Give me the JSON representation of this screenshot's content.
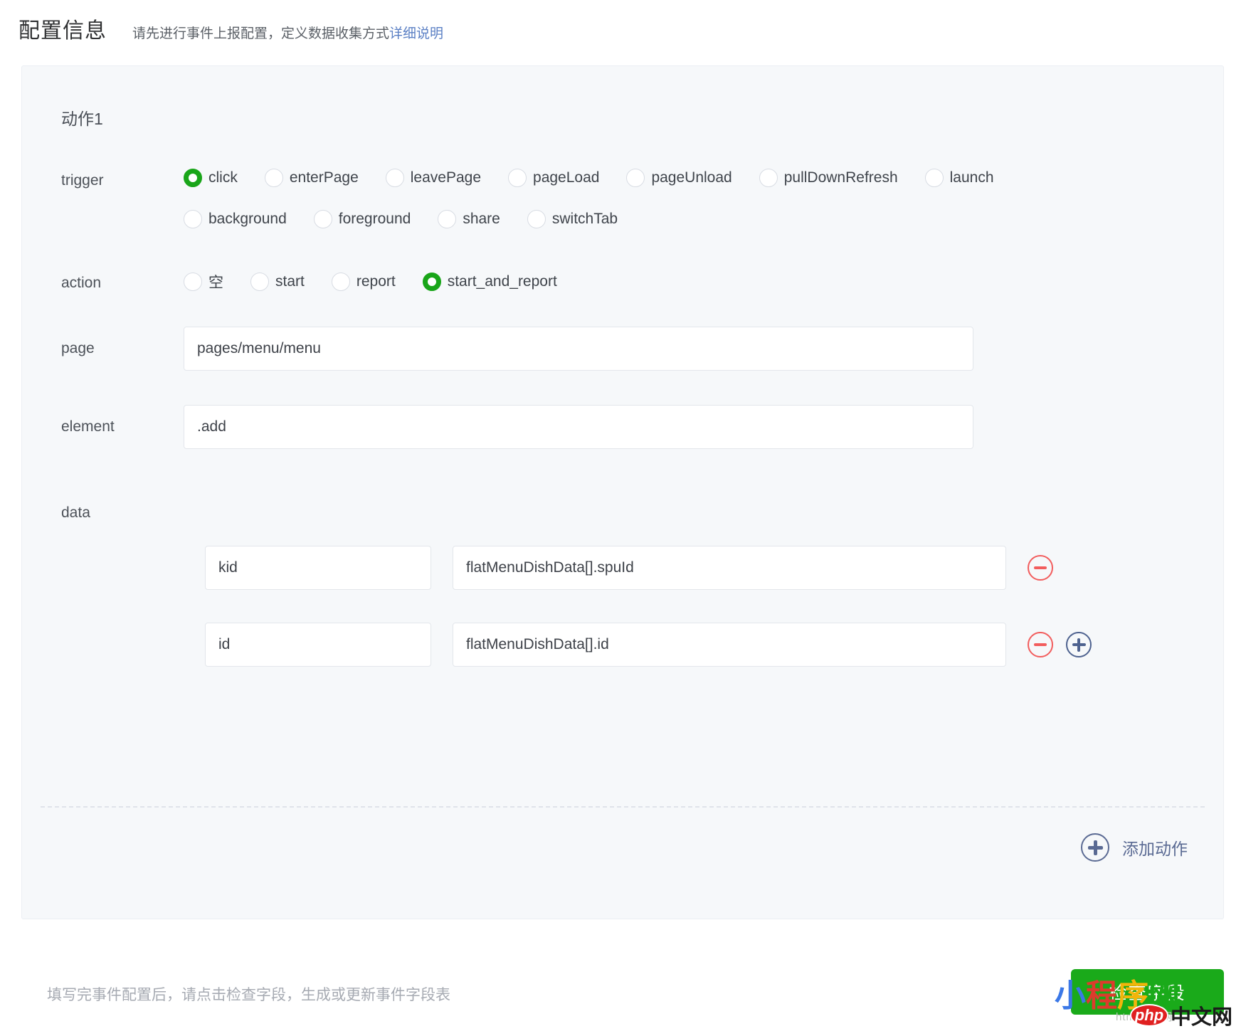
{
  "header": {
    "title": "配置信息",
    "subtitle": "请先进行事件上报配置，定义数据收集方式",
    "link": "详细说明"
  },
  "panel": {
    "action_title": "动作1"
  },
  "trigger": {
    "label": "trigger",
    "row1": [
      {
        "label": "click",
        "checked": true
      },
      {
        "label": "enterPage",
        "checked": false
      },
      {
        "label": "leavePage",
        "checked": false
      },
      {
        "label": "pageLoad",
        "checked": false
      },
      {
        "label": "pageUnload",
        "checked": false
      },
      {
        "label": "pullDownRefresh",
        "checked": false
      },
      {
        "label": "launch",
        "checked": false
      }
    ],
    "row2": [
      {
        "label": "background",
        "checked": false
      },
      {
        "label": "foreground",
        "checked": false
      },
      {
        "label": "share",
        "checked": false
      },
      {
        "label": "switchTab",
        "checked": false
      }
    ]
  },
  "action": {
    "label": "action",
    "options": [
      {
        "label": "空",
        "checked": false
      },
      {
        "label": "start",
        "checked": false
      },
      {
        "label": "report",
        "checked": false
      },
      {
        "label": "start_and_report",
        "checked": true
      }
    ]
  },
  "page_field": {
    "label": "page",
    "value": "pages/menu/menu"
  },
  "element_field": {
    "label": "element",
    "value": ".add"
  },
  "data_section": {
    "label": "data",
    "rows": [
      {
        "key": "kid",
        "value": "flatMenuDishData[].spuId",
        "has_add": false
      },
      {
        "key": "id",
        "value": "flatMenuDishData[].id",
        "has_add": true
      }
    ]
  },
  "add_action": {
    "label": "添加动作"
  },
  "footer": {
    "hint": "填写完事件配置后，请点击检查字段，生成或更新事件字段表",
    "button": "检查字段"
  },
  "watermark": {
    "chars": [
      "小",
      "程",
      "序",
      "网"
    ],
    "html_text": "html中文网",
    "php": "php",
    "cn": "中文网"
  },
  "colors": {
    "accent_green": "#1aaa1a",
    "radio_green": "#19a519",
    "minus_red": "#f25d5d",
    "plus_blue": "#4e628f",
    "link_blue": "#5a7fc4",
    "panel_bg": "#f6f8fa"
  }
}
